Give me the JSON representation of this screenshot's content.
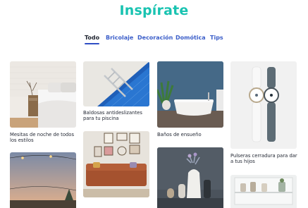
{
  "page": {
    "title": "Inspírate"
  },
  "tabs": [
    {
      "label": "Todo",
      "active": true
    },
    {
      "label": "Bricolaje",
      "active": false
    },
    {
      "label": "Decoración",
      "active": false
    },
    {
      "label": "Domótica",
      "active": false
    },
    {
      "label": "Tips",
      "active": false
    }
  ],
  "cards": [
    {
      "caption": "Mesitas de noche de todos los estilos",
      "image": "bedroom-bedside-table"
    },
    {
      "caption": "Baldosas antideslizantes para tu piscina",
      "image": "pool-ladder-tiles"
    },
    {
      "caption": "Baños de ensueño",
      "image": "bathroom-freestanding-tub"
    },
    {
      "caption": "Pulseras cerradura para dar a tus hijos",
      "image": "smart-watches"
    },
    {
      "caption": "",
      "image": "string-lights-sunset"
    },
    {
      "caption": "",
      "image": "living-room-gallery-wall"
    },
    {
      "caption": "",
      "image": "vases-on-shelf"
    },
    {
      "caption": "",
      "image": "kitchen-shelf-jars"
    }
  ],
  "colors": {
    "accent": "#19c3b1",
    "tab_text": "#3b5ec9",
    "tab_underline": "#2f4ec4"
  }
}
